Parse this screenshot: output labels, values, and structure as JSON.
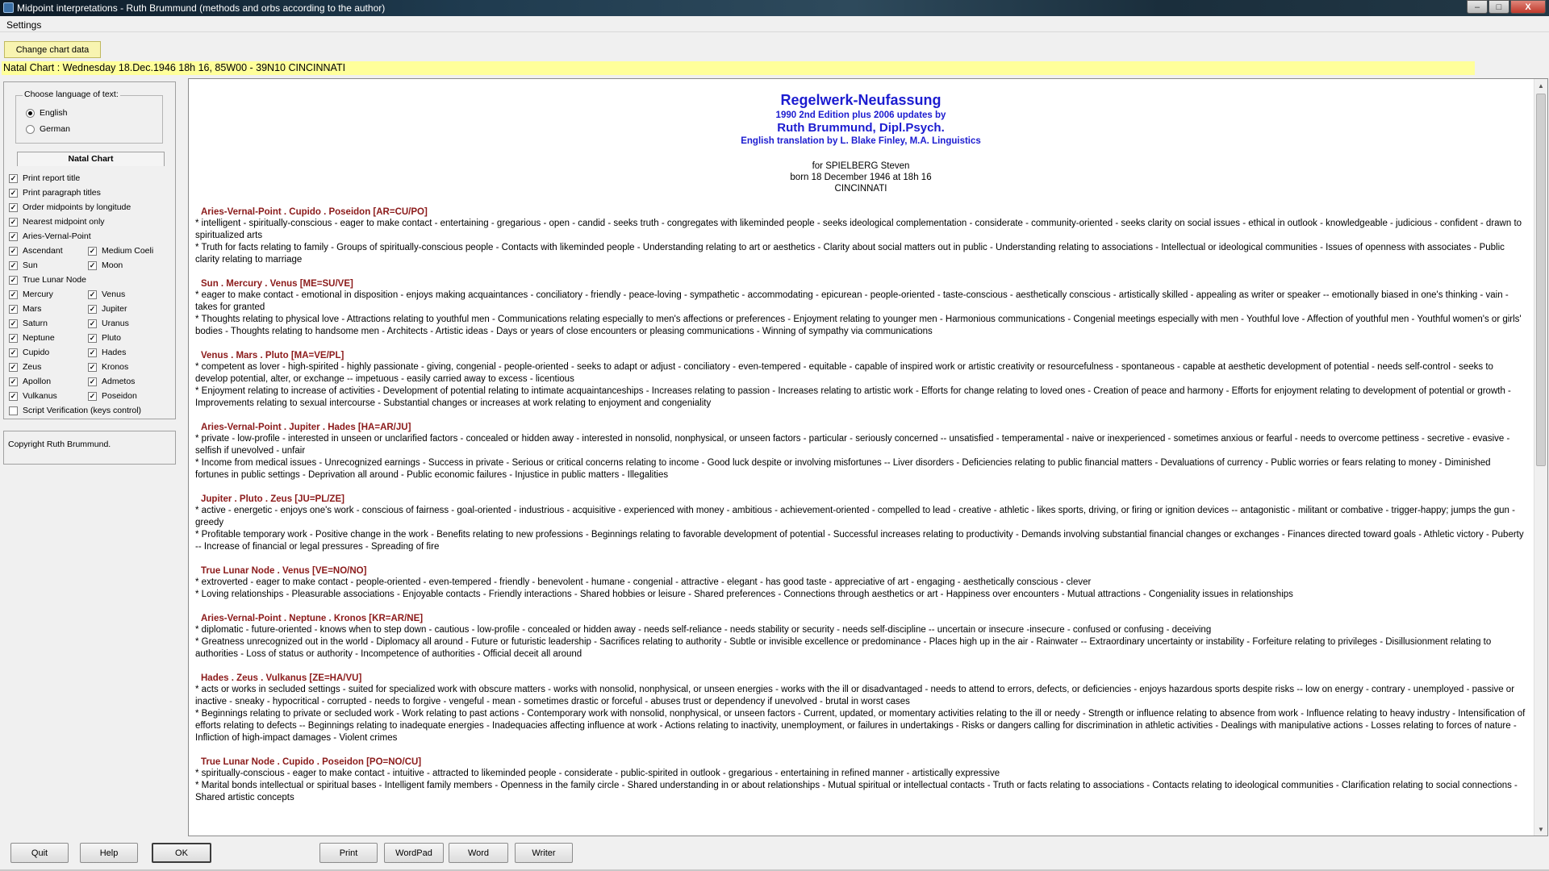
{
  "window": {
    "title": "Midpoint interpretations - Ruth Brummund (methods and orbs according to the author)",
    "controls": [
      "–",
      "□",
      "X"
    ]
  },
  "menu": {
    "settings": "Settings"
  },
  "change_chart_button": "Change chart data",
  "chart_info": "Natal Chart : Wednesday 18.Dec.1946 18h 16, 85W00 - 39N10  CINCINNATI",
  "language": {
    "legend": "Choose language of text:",
    "options": [
      {
        "label": "English",
        "selected": true
      },
      {
        "label": "German",
        "selected": false
      }
    ]
  },
  "tab_label": "Natal Chart",
  "options": [
    {
      "label": "Print report title",
      "checked": true
    },
    {
      "label": "Print paragraph titles",
      "checked": true
    },
    {
      "label": "Order midpoints by longitude",
      "checked": true
    },
    {
      "label": "Nearest midpoint only",
      "checked": true
    },
    {
      "label": "Aries-Vernal-Point",
      "checked": true
    },
    {
      "label": "Ascendant",
      "checked": true
    },
    {
      "label": "Medium Coeli",
      "checked": true
    },
    {
      "label": "Sun",
      "checked": true
    },
    {
      "label": "Moon",
      "checked": true
    },
    {
      "label": "True Lunar Node",
      "checked": true
    },
    {
      "label": "Mercury",
      "checked": true
    },
    {
      "label": "Venus",
      "checked": true
    },
    {
      "label": "Mars",
      "checked": true
    },
    {
      "label": "Jupiter",
      "checked": true
    },
    {
      "label": "Saturn",
      "checked": true
    },
    {
      "label": "Uranus",
      "checked": true
    },
    {
      "label": "Neptune",
      "checked": true
    },
    {
      "label": "Pluto",
      "checked": true
    },
    {
      "label": "Cupido",
      "checked": true
    },
    {
      "label": "Hades",
      "checked": true
    },
    {
      "label": "Zeus",
      "checked": true
    },
    {
      "label": "Kronos",
      "checked": true
    },
    {
      "label": "Apollon",
      "checked": true
    },
    {
      "label": "Admetos",
      "checked": true
    },
    {
      "label": "Vulkanus",
      "checked": true
    },
    {
      "label": "Poseidon",
      "checked": true
    },
    {
      "label": "Script Verification (keys control)",
      "checked": false
    }
  ],
  "copyright": "Copyright Ruth Brummund.",
  "report": {
    "title": "Regelwerk-Neufassung",
    "edition": "1990 2nd Edition plus 2006 updates by",
    "author": "Ruth Brummund, Dipl.Psych.",
    "translation": "English translation by L. Blake Finley, M.A. Linguistics",
    "for_line": "for SPIELBERG Steven",
    "born_line": "born 18 December 1946 at 18h 16",
    "place_line": "CINCINNATI",
    "midpoints": [
      {
        "title": "Aries-Vernal-Point . Cupido . Poseidon [AR=CU/PO]",
        "lines": [
          "*  intelligent - spiritually-conscious - eager to make contact - entertaining - gregarious - open - candid - seeks truth - congregates with likeminded people - seeks ideological complementation - considerate - community-oriented - seeks clarity on social issues - ethical in outlook - knowledgeable - judicious - confident - drawn to spiritualized arts",
          "*  Truth for facts relating to family - Groups of spiritually-conscious people - Contacts with likeminded people - Understanding relating to art or aesthetics - Clarity about social matters out in public - Understanding relating to associations - Intellectual or ideological communities - Issues of openness with associates - Public clarity relating to marriage"
        ]
      },
      {
        "title": "Sun . Mercury . Venus [ME=SU/VE]",
        "lines": [
          "*  eager to make contact - emotional in disposition - enjoys making acquaintances - conciliatory - friendly - peace-loving - sympathetic - accommodating - epicurean - people-oriented - taste-conscious - aesthetically conscious - artistically skilled - appealing as writer or speaker -- emotionally biased in one's thinking - vain - takes for granted",
          "*  Thoughts relating to physical love - Attractions relating to youthful men - Communications relating especially to men's affections or preferences - Enjoyment relating to younger men - Harmonious communications - Congenial meetings especially with men - Youthful love - Affection of youthful men - Youthful women's or girls' bodies - Thoughts relating to handsome men - Architects - Artistic ideas - Days or years of close encounters or pleasing communications - Winning of sympathy via communications"
        ]
      },
      {
        "title": "Venus . Mars . Pluto [MA=VE/PL]",
        "lines": [
          "*  competent as lover - high-spirited - highly passionate - giving, congenial - people-oriented - seeks to adapt or adjust - conciliatory - even-tempered - equitable - capable of inspired work or artistic creativity or resourcefulness - spontaneous - capable at aesthetic development of potential - needs self-control - seeks to develop potential, alter, or exchange -- impetuous - easily carried away to excess - licentious",
          "*  Enjoyment relating to increase of activities - Development of potential relating to intimate acquaintanceships - Increases relating to passion - Increases relating to artistic work - Efforts for change relating to loved ones - Creation of peace and harmony - Efforts for enjoyment relating to development of potential or growth  - Improvements relating to sexual intercourse - Substantial changes or increases at work relating to enjoyment and congeniality"
        ]
      },
      {
        "title": "Aries-Vernal-Point . Jupiter . Hades [HA=AR/JU]",
        "lines": [
          "*  private - low-profile - interested in unseen or unclarified factors - concealed or hidden away - interested in nonsolid, nonphysical, or unseen factors - particular - seriously concerned -- unsatisfied - temperamental - naive or inexperienced - sometimes anxious or fearful - needs to overcome pettiness - secretive - evasive - selfish if unevolved - unfair",
          "*  Income from medical issues - Unrecognized earnings - Success in private - Serious or critical concerns relating to income - Good luck despite or involving misfortunes -- Liver disorders - Deficiencies relating to public financial matters - Devaluations of currency - Public worries or fears relating to money - Diminished fortunes in public settings - Deprivation all around - Public economic failures - Injustice in public matters - Illegalities"
        ]
      },
      {
        "title": "Jupiter . Pluto . Zeus [JU=PL/ZE]",
        "lines": [
          "*  active - energetic - enjoys one's work - conscious of fairness - goal-oriented - industrious - acquisitive - experienced with money - ambitious - achievement-oriented - compelled to lead - creative - athletic - likes sports, driving, or firing or ignition devices -- antagonistic - militant or combative - trigger-happy; jumps the gun - greedy",
          "*  Profitable temporary work - Positive change in the work - Benefits relating to new professions - Beginnings relating to favorable development of potential - Successful increases relating to productivity - Demands involving substantial financial changes or exchanges - Finances directed toward goals - Athletic victory - Puberty -- Increase of financial or legal pressures - Spreading of fire"
        ]
      },
      {
        "title": "True Lunar Node . Venus [VE=NO/NO]",
        "lines": [
          "*  extroverted - eager to make contact - people-oriented - even-tempered - friendly -  benevolent - humane - congenial - attractive - elegant - has good taste - appreciative of art - engaging  - aesthetically conscious - clever",
          "*  Loving relationships - Pleasurable associations - Enjoyable contacts - Friendly interactions - Shared hobbies or leisure - Shared preferences - Connections through aesthetics or art - Happiness over encounters - Mutual attractions - Congeniality issues in relationships"
        ]
      },
      {
        "title": "Aries-Vernal-Point . Neptune . Kronos [KR=AR/NE]",
        "lines": [
          "*  diplomatic - future-oriented - knows when to step down - cautious - low-profile - concealed or hidden away - needs self-reliance - needs stability or security - needs self-discipline -- uncertain or insecure -insecure - confused or confusing - deceiving",
          "*  Greatness unrecognized out in the world - Diplomacy all around - Future or futuristic leadership - Sacrifices relating to authority - Subtle or invisible excellence or predominance - Places high up in the air - Rainwater -- Extraordinary uncertainty or instability - Forfeiture relating to privileges - Disillusionment relating to authorities - Loss of status or authority - Incompetence of authorities - Official deceit all around"
        ]
      },
      {
        "title": "Hades . Zeus . Vulkanus [ZE=HA/VU]",
        "lines": [
          "*  acts or works in secluded settings - suited for specialized work with obscure matters - works with nonsolid, nonphysical, or unseen energies - works with the ill or disadvantaged - needs to attend to errors, defects, or deficiencies - enjoys hazardous sports despite risks -- low on energy - contrary - unemployed - passive or inactive - sneaky - hypocritical - corrupted - needs to forgive - vengeful - mean - sometimes drastic or forceful - abuses trust or dependency if unevolved - brutal in worst cases",
          "*  Beginnings relating to private or secluded work - Work relating to past actions - Contemporary work with nonsolid, nonphysical, or unseen factors - Current, updated, or momentary activities relating to the ill or needy - Strength or influence relating to absence from work - Influence relating to heavy industry - Intensification of efforts relating to defects -- Beginnings relating to inadequate energies - Inadequacies affecting influence at work - Actions relating to inactivity, unemployment, or failures in undertakings - Risks or dangers calling for discrimination in athletic activities - Dealings with manipulative actions - Losses relating to forces of nature - Infliction of high-impact damages - Violent crimes"
        ]
      },
      {
        "title": "True Lunar Node . Cupido . Poseidon [PO=NO/CU]",
        "lines": [
          "*  spiritually-conscious - eager to make contact - intuitive - attracted to likeminded people - considerate - public-spirited in outlook - gregarious - entertaining in refined manner - artistically expressive",
          "*  Marital bonds intellectual or spiritual bases - Intelligent family members - Openness in the family circle - Shared understanding in or about relationships - Mutual spiritual or intellectual contacts - Truth or facts relating to associations - Contacts relating to ideological communities - Clarification relating to social connections - Shared artistic concepts"
        ]
      }
    ]
  },
  "buttons": {
    "quit": "Quit",
    "help": "Help",
    "ok": "OK",
    "print": "Print",
    "wordpad": "WordPad",
    "word": "Word",
    "writer": "Writer"
  },
  "scroll": {
    "up": "▲",
    "down": "▼"
  }
}
